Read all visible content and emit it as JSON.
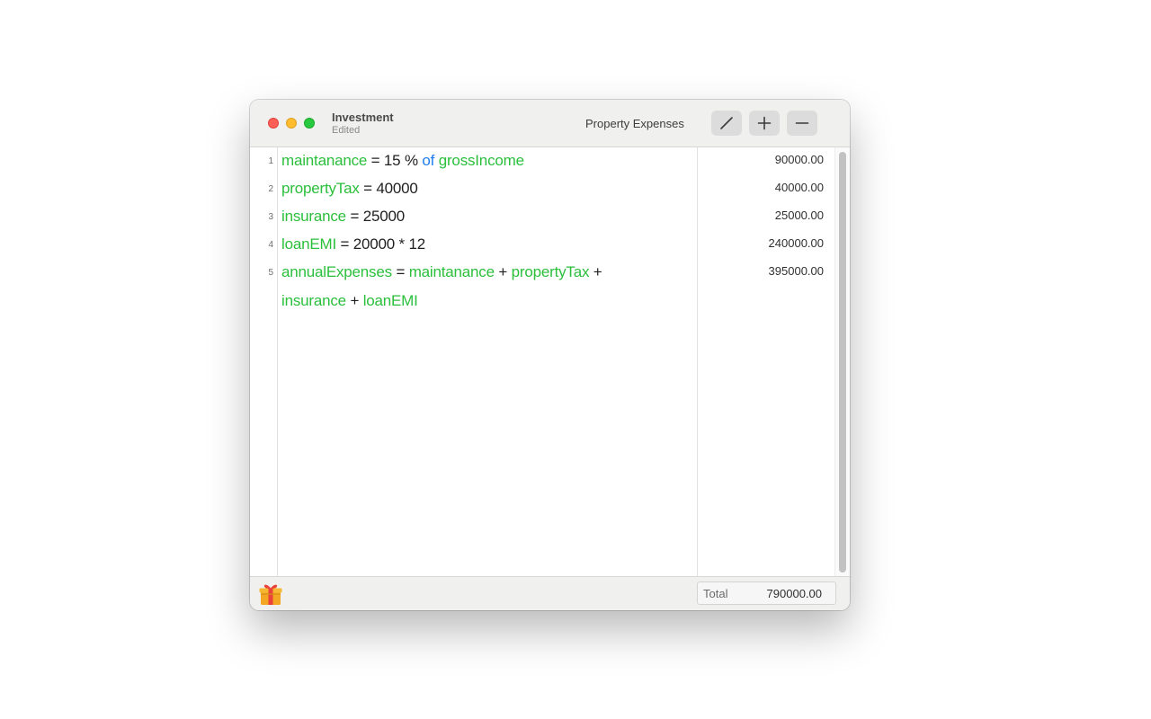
{
  "window": {
    "title": "Investment",
    "subtitle": "Edited",
    "sheet_name": "Property Expenses"
  },
  "toolbar": {
    "edit_icon": "pencil-slash-icon",
    "add_icon": "plus-icon",
    "remove_icon": "minus-icon"
  },
  "lines": [
    {
      "number": "1",
      "tokens": [
        {
          "text": "maintanance",
          "type": "var"
        },
        {
          "text": " = 15 % ",
          "type": "op"
        },
        {
          "text": "of",
          "type": "kw"
        },
        {
          "text": " ",
          "type": "op"
        },
        {
          "text": "grossIncome",
          "type": "var"
        }
      ],
      "result": "90000.00"
    },
    {
      "number": "2",
      "tokens": [
        {
          "text": "propertyTax",
          "type": "var"
        },
        {
          "text": " = 40000",
          "type": "op"
        }
      ],
      "result": "40000.00"
    },
    {
      "number": "3",
      "tokens": [
        {
          "text": "insurance",
          "type": "var"
        },
        {
          "text": " = 25000",
          "type": "op"
        }
      ],
      "result": "25000.00"
    },
    {
      "number": "4",
      "tokens": [
        {
          "text": "loanEMI",
          "type": "var"
        },
        {
          "text": " = 20000 * 12",
          "type": "op"
        }
      ],
      "result": "240000.00"
    },
    {
      "number": "5",
      "tokens": [
        {
          "text": "annualExpenses",
          "type": "var"
        },
        {
          "text": " = ",
          "type": "op"
        },
        {
          "text": "maintanance",
          "type": "var"
        },
        {
          "text": " + ",
          "type": "op"
        },
        {
          "text": "propertyTax",
          "type": "var"
        },
        {
          "text": " +",
          "type": "op"
        }
      ],
      "continuation": [
        {
          "text": "insurance",
          "type": "var"
        },
        {
          "text": " + ",
          "type": "op"
        },
        {
          "text": "loanEMI",
          "type": "var"
        }
      ],
      "result": "395000.00"
    }
  ],
  "footer": {
    "gift_icon": "gift-icon",
    "total_label": "Total",
    "total_value": "790000.00"
  },
  "colors": {
    "variable": "#2bbf3c",
    "keyword": "#1f7df0",
    "close": "#fe5f57",
    "minimize": "#febc2e",
    "maximize": "#28c840"
  }
}
